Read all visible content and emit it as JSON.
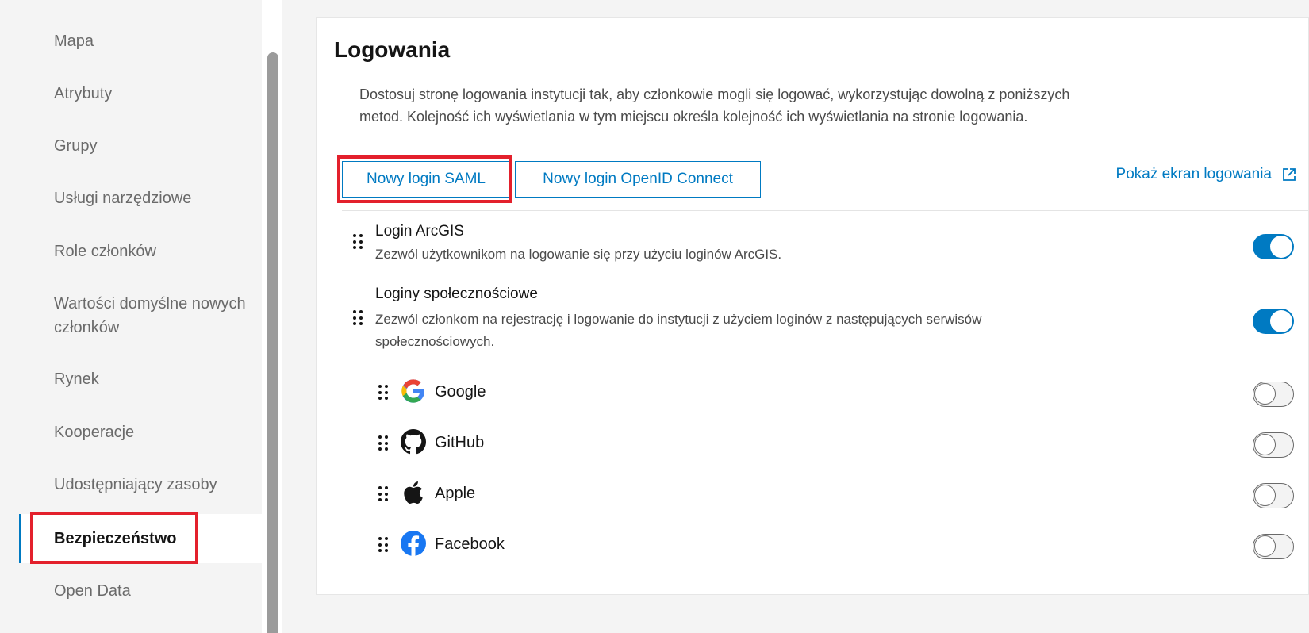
{
  "sidebar": {
    "items": [
      {
        "label": "Mapa"
      },
      {
        "label": "Atrybuty"
      },
      {
        "label": "Grupy"
      },
      {
        "label": "Usługi narzędziowe"
      },
      {
        "label": "Role członków"
      },
      {
        "label": "Wartości domyślne nowych"
      },
      {
        "label": "członków"
      },
      {
        "label": "Rynek"
      },
      {
        "label": "Kooperacje"
      },
      {
        "label": "Udostępniający zasoby"
      },
      {
        "label": "Bezpieczeństwo"
      },
      {
        "label": "Open Data"
      }
    ],
    "active_item": "Bezpieczeństwo"
  },
  "main": {
    "title": "Logowania",
    "intro_line1": "Dostosuj stronę logowania instytucji tak, aby członkowie mogli się logować, wykorzystując dowolną z poniższych",
    "intro_line2": "metod. Kolejność ich wyświetlania w tym miejscu określa kolejność ich wyświetlania na stronie logowania.",
    "buttons": {
      "saml": "Nowy login SAML",
      "openid": "Nowy login OpenID Connect"
    },
    "show_login_link": "Pokaż ekran logowania",
    "arcgis": {
      "title": "Login ArcGIS",
      "desc": "Zezwól użytkownikom na logowanie się przy użyciu loginów ArcGIS.",
      "enabled": true
    },
    "social": {
      "title": "Loginy społecznościowe",
      "desc_line1": "Zezwól członkom na rejestrację i logowanie do instytucji z użyciem loginów z następujących serwisów",
      "desc_line2": "społecznościowych.",
      "enabled": true,
      "providers": [
        {
          "label": "Google",
          "icon": "google-icon",
          "enabled": false
        },
        {
          "label": "GitHub",
          "icon": "github-icon",
          "enabled": false
        },
        {
          "label": "Apple",
          "icon": "apple-icon",
          "enabled": false
        },
        {
          "label": "Facebook",
          "icon": "facebook-icon",
          "enabled": false
        }
      ]
    }
  },
  "colors": {
    "accent": "#007ac2",
    "highlight": "#e3202c",
    "google_blue": "#4285f4",
    "google_red": "#ea4335",
    "google_yellow": "#fbbc05",
    "google_green": "#34a853",
    "facebook_blue": "#1877f2"
  }
}
